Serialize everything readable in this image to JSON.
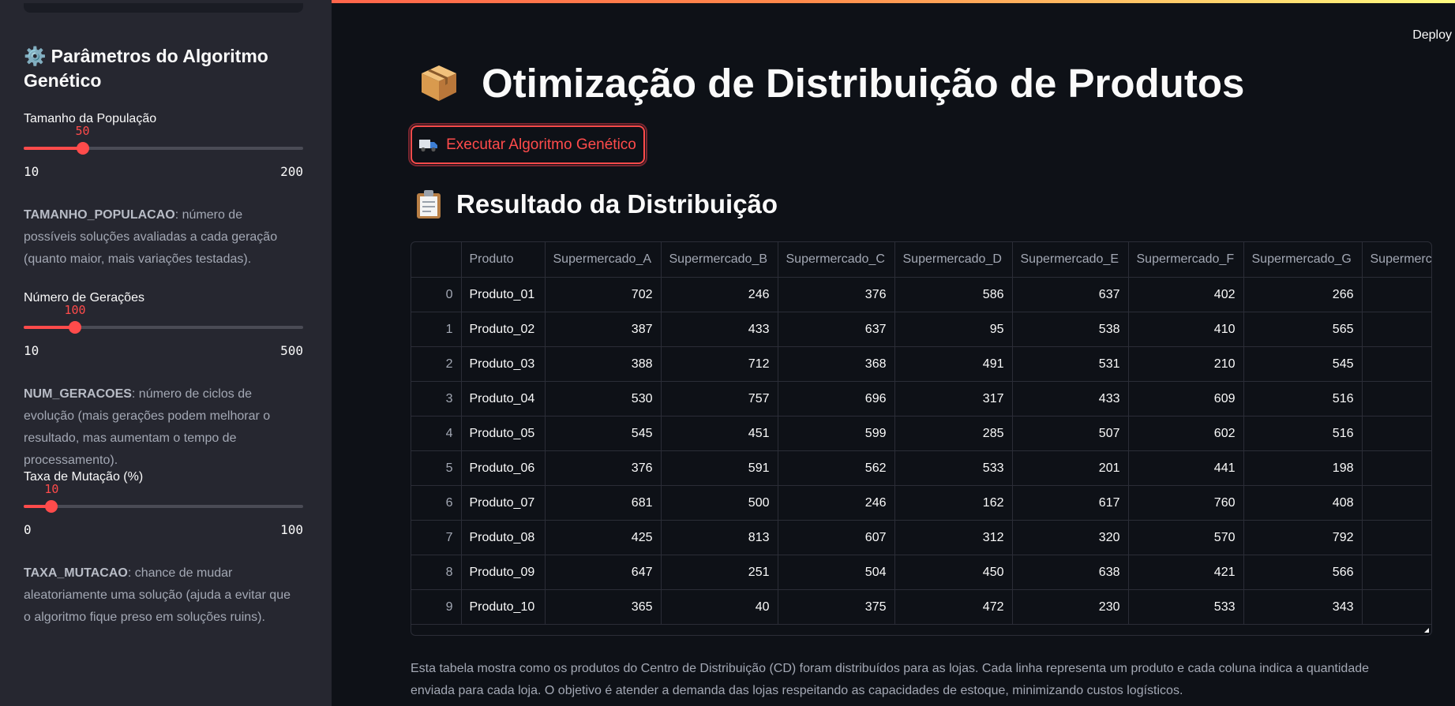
{
  "header": {
    "deploy_label": "Deploy"
  },
  "sidebar": {
    "title": "Parâmetros do Algoritmo Genético",
    "sliders": [
      {
        "label": "Tamanho da População",
        "value": "50",
        "min": "10",
        "max": "200",
        "fraction": 0.2105
      },
      {
        "label": "Número de Gerações",
        "value": "100",
        "min": "10",
        "max": "500",
        "fraction": 0.1837
      },
      {
        "label": "Taxa de Mutação (%)",
        "value": "10",
        "min": "0",
        "max": "100",
        "fraction": 0.1
      }
    ],
    "help": [
      {
        "key": "TAMANHO_POPULACAO",
        "text": ": número de possíveis soluções avaliadas a cada geração (quanto maior, mais variações testadas)."
      },
      {
        "key": "NUM_GERACOES",
        "text": ": número de ciclos de evolução (mais gerações podem melhorar o resultado, mas aumentam o tempo de processamento)."
      },
      {
        "key": "TAXA_MUTACAO",
        "text": ": chance de mudar aleatoriamente uma solução (ajuda a evitar que o algoritmo fique preso em soluções ruins)."
      }
    ]
  },
  "main": {
    "title": "Otimização de Distribuição de Produtos",
    "run_button": "Executar Algoritmo Genético",
    "result_title": "Resultado da Distribuição",
    "description": "Esta tabela mostra como os produtos do Centro de Distribuição (CD) foram distribuídos para as lojas. Cada linha representa um produto e cada coluna indica a quantidade enviada para cada loja. O objetivo é atender a demanda das lojas respeitando as capacidades de estoque, minimizando custos logísticos."
  },
  "table": {
    "columns": [
      "",
      "Produto",
      "Supermercado_A",
      "Supermercado_B",
      "Supermercado_C",
      "Supermercado_D",
      "Supermercado_E",
      "Supermercado_F",
      "Supermercado_G",
      "Supermercado_H"
    ],
    "rows": [
      [
        "0",
        "Produto_01",
        "702",
        "246",
        "376",
        "586",
        "637",
        "402",
        "266",
        ""
      ],
      [
        "1",
        "Produto_02",
        "387",
        "433",
        "637",
        "95",
        "538",
        "410",
        "565",
        ""
      ],
      [
        "2",
        "Produto_03",
        "388",
        "712",
        "368",
        "491",
        "531",
        "210",
        "545",
        ""
      ],
      [
        "3",
        "Produto_04",
        "530",
        "757",
        "696",
        "317",
        "433",
        "609",
        "516",
        ""
      ],
      [
        "4",
        "Produto_05",
        "545",
        "451",
        "599",
        "285",
        "507",
        "602",
        "516",
        ""
      ],
      [
        "5",
        "Produto_06",
        "376",
        "591",
        "562",
        "533",
        "201",
        "441",
        "198",
        ""
      ],
      [
        "6",
        "Produto_07",
        "681",
        "500",
        "246",
        "162",
        "617",
        "760",
        "408",
        ""
      ],
      [
        "7",
        "Produto_08",
        "425",
        "813",
        "607",
        "312",
        "320",
        "570",
        "792",
        ""
      ],
      [
        "8",
        "Produto_09",
        "647",
        "251",
        "504",
        "450",
        "638",
        "421",
        "566",
        ""
      ],
      [
        "9",
        "Produto_10",
        "365",
        "40",
        "375",
        "472",
        "230",
        "533",
        "343",
        ""
      ]
    ]
  },
  "colors": {
    "accent": "#ff4b4b",
    "background": "#0e1117",
    "sidebar": "#262730"
  },
  "icons": {
    "sidebar_title": "gear-icon",
    "main_title": "package-icon",
    "run_button": "truck-icon",
    "result_title": "clipboard-icon"
  }
}
